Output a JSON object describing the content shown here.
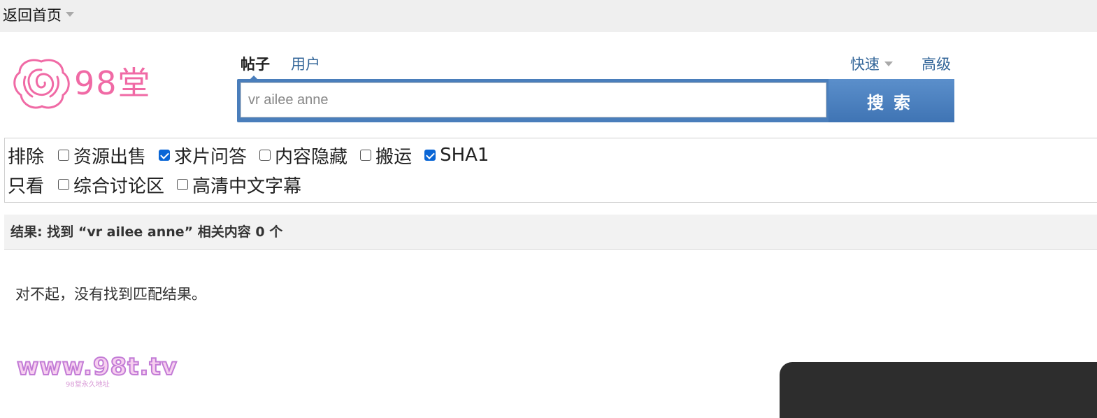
{
  "topbar": {
    "home_label": "返回首页"
  },
  "logo": {
    "text": "98堂",
    "icon": "rose-icon",
    "color": "#f06aa5"
  },
  "search": {
    "tabs": [
      {
        "label": "帖子",
        "active": true
      },
      {
        "label": "用户",
        "active": false
      }
    ],
    "quick_label": "快速",
    "advanced_label": "高级",
    "input_value": "vr ailee anne",
    "button_label": "搜索",
    "accent_color": "#4a7ebb"
  },
  "filters": {
    "exclude_label": "排除",
    "exclude_options": [
      {
        "label": "资源出售",
        "checked": false
      },
      {
        "label": "求片问答",
        "checked": true
      },
      {
        "label": "内容隐藏",
        "checked": false
      },
      {
        "label": "搬运",
        "checked": false
      },
      {
        "label": "SHA1",
        "checked": true
      }
    ],
    "only_label": "只看",
    "only_options": [
      {
        "label": "综合讨论区",
        "checked": false
      },
      {
        "label": "高清中文字幕",
        "checked": false
      }
    ]
  },
  "results": {
    "summary": "结果: 找到 “vr ailee anne” 相关内容 0 个",
    "empty_message": "对不起，没有找到匹配结果。"
  },
  "watermark": {
    "main": "www.98t.tv",
    "sub": "98堂永久地址"
  }
}
